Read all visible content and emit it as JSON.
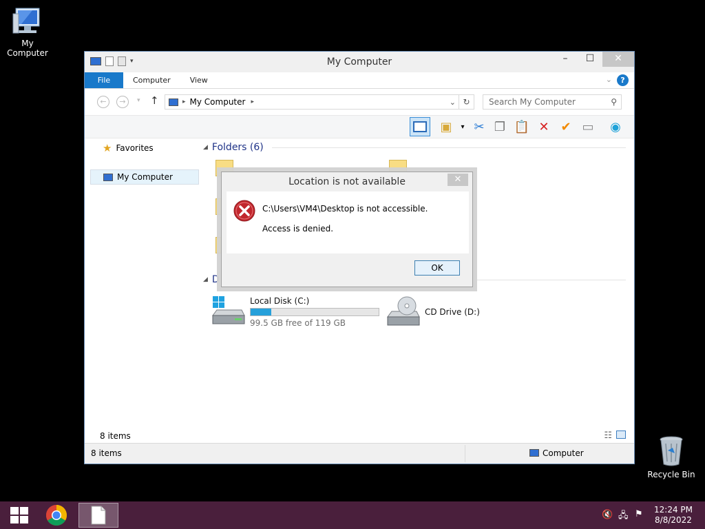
{
  "desktop": {
    "my_computer_label": "My Computer",
    "recycle_bin_label": "Recycle Bin"
  },
  "window": {
    "title": "My Computer",
    "tabs": [
      "File",
      "Computer",
      "View"
    ],
    "address": {
      "location": "My Computer"
    },
    "search_placeholder": "Search My Computer",
    "nav": {
      "favorites": "Favorites",
      "my_computer": "My Computer"
    },
    "folders_header": "Folders (6)",
    "devices_header_partial": "D",
    "drives": [
      {
        "name": "Local Disk (C:)",
        "free_text": "99.5 GB free of 119 GB",
        "used_fraction": 0.16
      },
      {
        "name": "CD Drive (D:)"
      }
    ],
    "item_count_inner": "8 items",
    "status_left": "8 items",
    "status_right": "Computer"
  },
  "dialog": {
    "title": "Location is not available",
    "message": "C:\\Users\\VM4\\Desktop is not accessible.",
    "detail": "Access is denied.",
    "ok_label": "OK"
  },
  "taskbar": {
    "time": "12:24 PM",
    "date": "8/8/2022"
  },
  "colors": {
    "accent": "#1979ca",
    "taskbar": "#4a1f3c",
    "error": "#c1272d",
    "drive_fill": "#26a0da"
  }
}
